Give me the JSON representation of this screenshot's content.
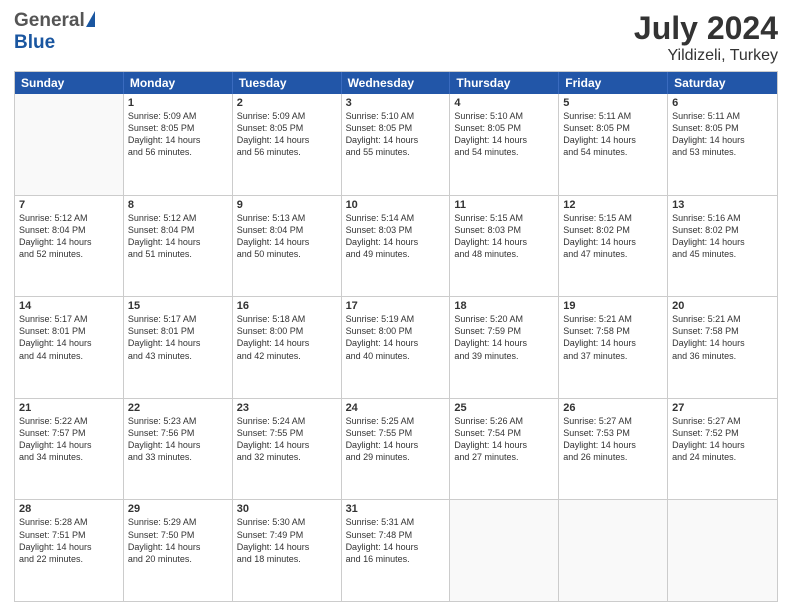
{
  "header": {
    "logo_general": "General",
    "logo_blue": "Blue",
    "month_year": "July 2024",
    "location": "Yildizeli, Turkey"
  },
  "days_of_week": [
    "Sunday",
    "Monday",
    "Tuesday",
    "Wednesday",
    "Thursday",
    "Friday",
    "Saturday"
  ],
  "weeks": [
    [
      {
        "day": "",
        "info": ""
      },
      {
        "day": "1",
        "info": "Sunrise: 5:09 AM\nSunset: 8:05 PM\nDaylight: 14 hours\nand 56 minutes."
      },
      {
        "day": "2",
        "info": "Sunrise: 5:09 AM\nSunset: 8:05 PM\nDaylight: 14 hours\nand 56 minutes."
      },
      {
        "day": "3",
        "info": "Sunrise: 5:10 AM\nSunset: 8:05 PM\nDaylight: 14 hours\nand 55 minutes."
      },
      {
        "day": "4",
        "info": "Sunrise: 5:10 AM\nSunset: 8:05 PM\nDaylight: 14 hours\nand 54 minutes."
      },
      {
        "day": "5",
        "info": "Sunrise: 5:11 AM\nSunset: 8:05 PM\nDaylight: 14 hours\nand 54 minutes."
      },
      {
        "day": "6",
        "info": "Sunrise: 5:11 AM\nSunset: 8:05 PM\nDaylight: 14 hours\nand 53 minutes."
      }
    ],
    [
      {
        "day": "7",
        "info": "Sunrise: 5:12 AM\nSunset: 8:04 PM\nDaylight: 14 hours\nand 52 minutes."
      },
      {
        "day": "8",
        "info": "Sunrise: 5:12 AM\nSunset: 8:04 PM\nDaylight: 14 hours\nand 51 minutes."
      },
      {
        "day": "9",
        "info": "Sunrise: 5:13 AM\nSunset: 8:04 PM\nDaylight: 14 hours\nand 50 minutes."
      },
      {
        "day": "10",
        "info": "Sunrise: 5:14 AM\nSunset: 8:03 PM\nDaylight: 14 hours\nand 49 minutes."
      },
      {
        "day": "11",
        "info": "Sunrise: 5:15 AM\nSunset: 8:03 PM\nDaylight: 14 hours\nand 48 minutes."
      },
      {
        "day": "12",
        "info": "Sunrise: 5:15 AM\nSunset: 8:02 PM\nDaylight: 14 hours\nand 47 minutes."
      },
      {
        "day": "13",
        "info": "Sunrise: 5:16 AM\nSunset: 8:02 PM\nDaylight: 14 hours\nand 45 minutes."
      }
    ],
    [
      {
        "day": "14",
        "info": "Sunrise: 5:17 AM\nSunset: 8:01 PM\nDaylight: 14 hours\nand 44 minutes."
      },
      {
        "day": "15",
        "info": "Sunrise: 5:17 AM\nSunset: 8:01 PM\nDaylight: 14 hours\nand 43 minutes."
      },
      {
        "day": "16",
        "info": "Sunrise: 5:18 AM\nSunset: 8:00 PM\nDaylight: 14 hours\nand 42 minutes."
      },
      {
        "day": "17",
        "info": "Sunrise: 5:19 AM\nSunset: 8:00 PM\nDaylight: 14 hours\nand 40 minutes."
      },
      {
        "day": "18",
        "info": "Sunrise: 5:20 AM\nSunset: 7:59 PM\nDaylight: 14 hours\nand 39 minutes."
      },
      {
        "day": "19",
        "info": "Sunrise: 5:21 AM\nSunset: 7:58 PM\nDaylight: 14 hours\nand 37 minutes."
      },
      {
        "day": "20",
        "info": "Sunrise: 5:21 AM\nSunset: 7:58 PM\nDaylight: 14 hours\nand 36 minutes."
      }
    ],
    [
      {
        "day": "21",
        "info": "Sunrise: 5:22 AM\nSunset: 7:57 PM\nDaylight: 14 hours\nand 34 minutes."
      },
      {
        "day": "22",
        "info": "Sunrise: 5:23 AM\nSunset: 7:56 PM\nDaylight: 14 hours\nand 33 minutes."
      },
      {
        "day": "23",
        "info": "Sunrise: 5:24 AM\nSunset: 7:55 PM\nDaylight: 14 hours\nand 32 minutes."
      },
      {
        "day": "24",
        "info": "Sunrise: 5:25 AM\nSunset: 7:55 PM\nDaylight: 14 hours\nand 29 minutes."
      },
      {
        "day": "25",
        "info": "Sunrise: 5:26 AM\nSunset: 7:54 PM\nDaylight: 14 hours\nand 27 minutes."
      },
      {
        "day": "26",
        "info": "Sunrise: 5:27 AM\nSunset: 7:53 PM\nDaylight: 14 hours\nand 26 minutes."
      },
      {
        "day": "27",
        "info": "Sunrise: 5:27 AM\nSunset: 7:52 PM\nDaylight: 14 hours\nand 24 minutes."
      }
    ],
    [
      {
        "day": "28",
        "info": "Sunrise: 5:28 AM\nSunset: 7:51 PM\nDaylight: 14 hours\nand 22 minutes."
      },
      {
        "day": "29",
        "info": "Sunrise: 5:29 AM\nSunset: 7:50 PM\nDaylight: 14 hours\nand 20 minutes."
      },
      {
        "day": "30",
        "info": "Sunrise: 5:30 AM\nSunset: 7:49 PM\nDaylight: 14 hours\nand 18 minutes."
      },
      {
        "day": "31",
        "info": "Sunrise: 5:31 AM\nSunset: 7:48 PM\nDaylight: 14 hours\nand 16 minutes."
      },
      {
        "day": "",
        "info": ""
      },
      {
        "day": "",
        "info": ""
      },
      {
        "day": "",
        "info": ""
      }
    ]
  ]
}
